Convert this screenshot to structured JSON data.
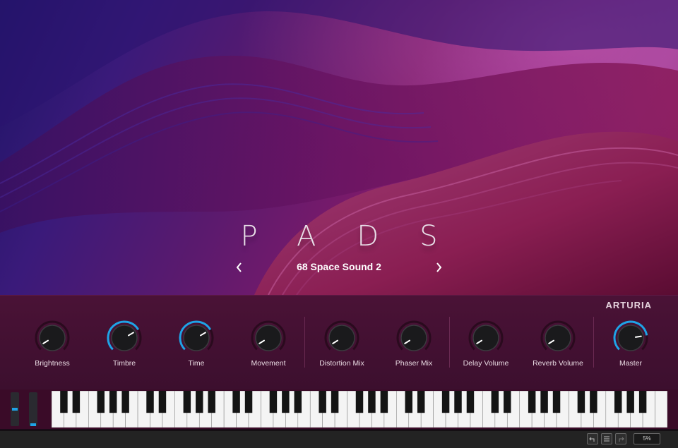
{
  "header": {
    "title": "PADS",
    "preset_name": "68 Space Sound 2",
    "prev_icon": "chevron-left-icon",
    "next_icon": "chevron-right-icon"
  },
  "panel": {
    "brand": "ARTURIA",
    "knobs": [
      {
        "label": "Brightness",
        "value": 0.05,
        "active": false
      },
      {
        "label": "Timbre",
        "value": 0.72,
        "active": true
      },
      {
        "label": "Time",
        "value": 0.72,
        "active": true
      },
      {
        "label": "Movement",
        "value": 0.05,
        "active": false
      },
      {
        "label": "Distortion Mix",
        "value": 0.05,
        "active": false
      },
      {
        "label": "Phaser Mix",
        "value": 0.05,
        "active": false
      },
      {
        "label": "Delay Volume",
        "value": 0.05,
        "active": false
      },
      {
        "label": "Reverb Volume",
        "value": 0.05,
        "active": false
      },
      {
        "label": "Master",
        "value": 0.8,
        "active": true
      }
    ]
  },
  "keyboard": {
    "pitch_wheel_value": 0.5,
    "mod_wheel_value": 0.0,
    "octaves": 7,
    "extra_white_keys": 1
  },
  "statusbar": {
    "undo_icon": "undo-icon",
    "history_icon": "menu-icon",
    "redo_icon": "redo-icon",
    "cpu": "5%"
  },
  "colors": {
    "accent": "#1fa3e6",
    "panel": "#3c0f2e"
  }
}
